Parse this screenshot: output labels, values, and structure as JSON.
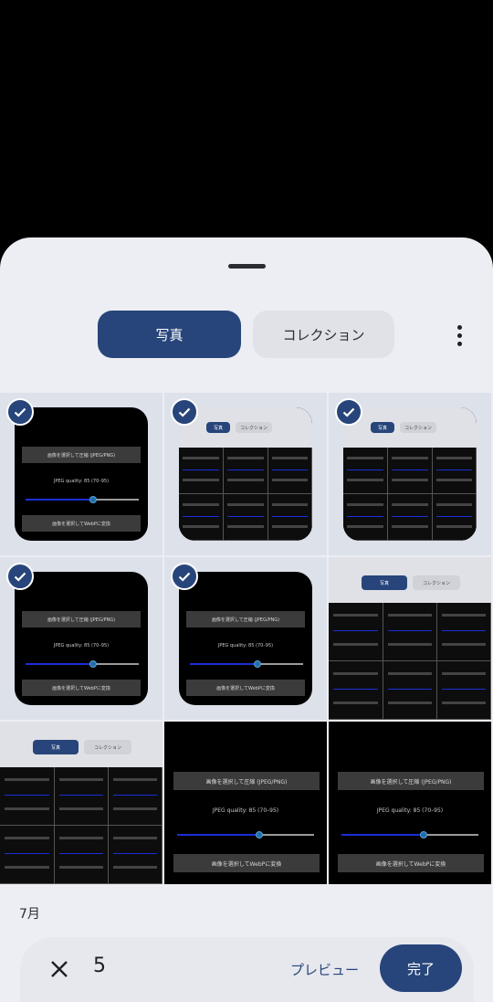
{
  "tabs": {
    "photos": "写真",
    "collection": "コレクション"
  },
  "icons": {
    "more": "more-vert-icon",
    "check": "check-icon",
    "close": "close-icon"
  },
  "app_screen": {
    "compress_button": "画像を選択して圧縮 (JPEG/PNG)",
    "quality_label": "JPEG quality: 85 (70–95)",
    "webp_button": "画像を選択してWebPに変換",
    "quality_fraction": 0.6
  },
  "section_label": "7月",
  "bottom_bar": {
    "count": "5",
    "preview_label": "プレビュー",
    "done_label": "完了"
  },
  "colors": {
    "accent": "#27457a",
    "sheet": "#eceef3",
    "slider_fill": "#1a2fd6"
  }
}
